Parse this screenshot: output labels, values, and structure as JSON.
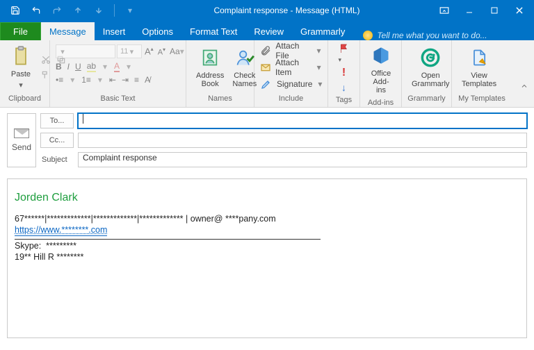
{
  "window": {
    "title": "Complaint response - Message (HTML)"
  },
  "tabs": {
    "file": "File",
    "items": [
      "Message",
      "Insert",
      "Options",
      "Format Text",
      "Review",
      "Grammarly"
    ],
    "active": "Message",
    "tellme": "Tell me what you want to do..."
  },
  "ribbon": {
    "clipboard": {
      "label": "Clipboard",
      "paste": "Paste"
    },
    "basicText": {
      "label": "Basic Text",
      "fontName": "",
      "fontSize": "11"
    },
    "names": {
      "label": "Names",
      "addressBook": "Address\nBook",
      "checkNames": "Check\nNames"
    },
    "include": {
      "label": "Include",
      "attachFile": "Attach File",
      "attachItem": "Attach Item",
      "signature": "Signature"
    },
    "tags": {
      "label": "Tags"
    },
    "addins": {
      "label": "Add-ins",
      "office": "Office\nAdd-ins"
    },
    "grammarly": {
      "label": "Grammarly",
      "open": "Open\nGrammarly"
    },
    "templates": {
      "label": "My Templates",
      "view": "View\nTemplates"
    }
  },
  "compose": {
    "send": "Send",
    "to": "To...",
    "cc": "Cc...",
    "subjectLabel": "Subject",
    "toValue": "",
    "ccValue": "",
    "subjectValue": "Complaint response"
  },
  "signature": {
    "name": "Jorden Clark",
    "line1": "67******|*************|*************|*************  | owner@ ****pany.com",
    "url": "https://www.********.com",
    "skypeLabel": "Skype:",
    "skypeValue": "*********",
    "address": "19** Hill R ********"
  }
}
